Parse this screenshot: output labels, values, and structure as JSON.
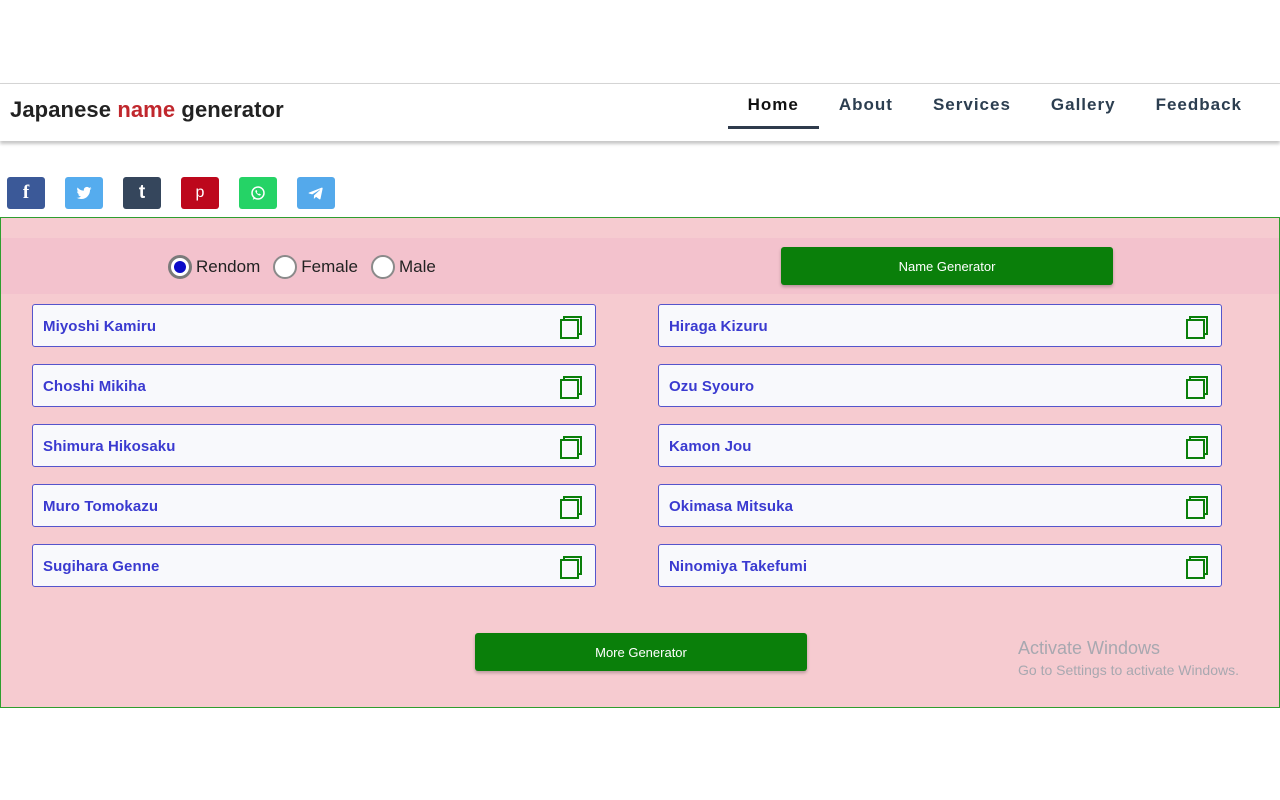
{
  "brand": {
    "part1": "Japanese ",
    "accent": "name",
    "part2": " generator",
    "accent_color": "#c0272d"
  },
  "nav": {
    "items": [
      {
        "label": "Home",
        "active": true
      },
      {
        "label": "About",
        "active": false
      },
      {
        "label": "Services",
        "active": false
      },
      {
        "label": "Gallery",
        "active": false
      },
      {
        "label": "Feedback",
        "active": false
      }
    ]
  },
  "share": {
    "buttons": [
      {
        "icon": "facebook-icon",
        "glyph": "f",
        "color": "#3b5998"
      },
      {
        "icon": "twitter-icon",
        "color": "#55acee"
      },
      {
        "icon": "tumblr-icon",
        "glyph": "t",
        "color": "#35465c"
      },
      {
        "icon": "pinterest-icon",
        "glyph": "p",
        "color": "#bd081c"
      },
      {
        "icon": "whatsapp-icon",
        "color": "#25d366"
      },
      {
        "icon": "telegram-icon",
        "color": "#54a9eb"
      }
    ]
  },
  "generator": {
    "gender_options": [
      {
        "label": "Rendom",
        "checked": true
      },
      {
        "label": "Female",
        "checked": false
      },
      {
        "label": "Male",
        "checked": false
      }
    ],
    "generate_button": "Name Generator",
    "names": [
      "Miyoshi Kamiru",
      "Hiraga Kizuru",
      "Choshi Mikiha",
      "Ozu Syouro",
      "Shimura Hikosaku",
      "Kamon Jou",
      "Muro Tomokazu",
      "Okimasa Mitsuka",
      "Sugihara Genne",
      "Ninomiya Takefumi"
    ],
    "more_button": "More Generator",
    "button_color": "#0a7f0a",
    "name_color": "#3a3ad0",
    "panel_color": "#f6cbd0"
  },
  "watermark": {
    "title": "Activate Windows",
    "subtitle": "Go to Settings to activate Windows."
  }
}
